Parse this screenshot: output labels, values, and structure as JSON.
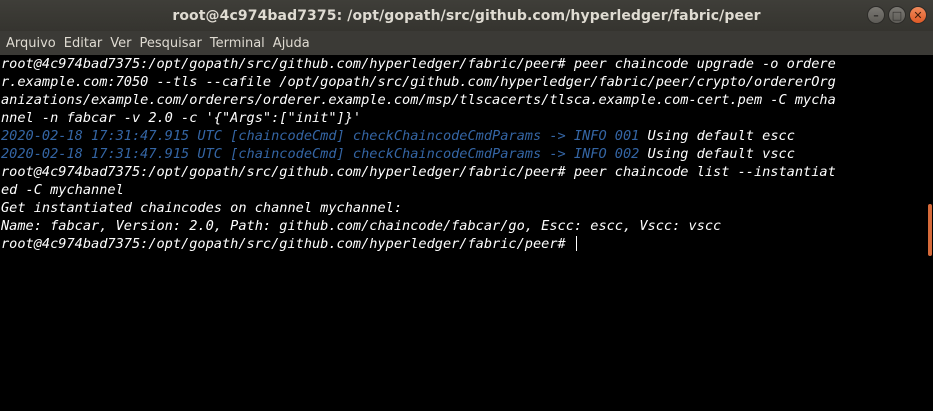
{
  "window": {
    "title": "root@4c974bad7375: /opt/gopath/src/github.com/hyperledger/fabric/peer",
    "controls": {
      "minimize": "–",
      "maximize": "□",
      "close": "✕"
    }
  },
  "menu": [
    "Arquivo",
    "Editar",
    "Ver",
    "Pesquisar",
    "Terminal",
    "Ajuda"
  ],
  "terminal": {
    "lines": [
      {
        "text": "root@4c974bad7375:/opt/gopath/src/github.com/hyperledger/fabric/peer# peer chaincode upgrade -o ordere"
      },
      {
        "text": "r.example.com:7050 --tls --cafile /opt/gopath/src/github.com/hyperledger/fabric/peer/crypto/ordererOrg"
      },
      {
        "text": "anizations/example.com/orderers/orderer.example.com/msp/tlscacerts/tlsca.example.com-cert.pem -C mycha"
      },
      {
        "text": "nnel -n fabcar -v 2.0 -c '{\"Args\":[\"init\"]}'"
      },
      {
        "log": "2020-02-18 17:31:47.915 UTC [chaincodeCmd] checkChaincodeCmdParams -> INFO 001",
        "text": " Using default escc"
      },
      {
        "log": "2020-02-18 17:31:47.915 UTC [chaincodeCmd] checkChaincodeCmdParams -> INFO 002",
        "text": " Using default vscc"
      },
      {
        "text": "root@4c974bad7375:/opt/gopath/src/github.com/hyperledger/fabric/peer# peer chaincode list --instantiat"
      },
      {
        "text": "ed -C mychannel"
      },
      {
        "text": "Get instantiated chaincodes on channel mychannel:"
      },
      {
        "text": "Name: fabcar, Version: 2.0, Path: github.com/chaincode/fabcar/go, Escc: escc, Vscc: vscc"
      },
      {
        "text": "root@4c974bad7375:/opt/gopath/src/github.com/hyperledger/fabric/peer# ",
        "cursor": true
      }
    ]
  },
  "colors": {
    "background": "#000000",
    "foreground": "#ffffff",
    "log_blue": "#3465a4",
    "scroll_thumb": "#d66a3a"
  }
}
